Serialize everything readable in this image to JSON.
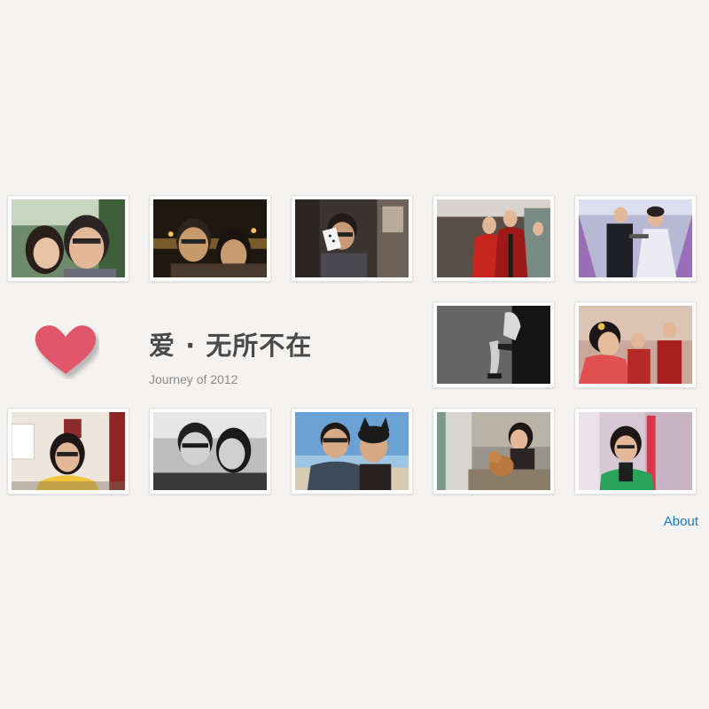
{
  "header": {
    "title": "爱 · 无所不在",
    "subtitle": "Journey of 2012"
  },
  "footer": {
    "about_label": "About"
  },
  "colors": {
    "background": "#f4f3f2",
    "heart": "#e0566b",
    "link": "#1a7bc0"
  },
  "icons": {
    "heart": "heart-icon"
  },
  "gallery": {
    "photo_count": 12
  }
}
